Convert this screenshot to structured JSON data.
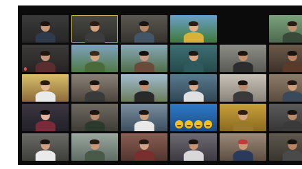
{
  "window": {
    "title": ""
  },
  "tiles": [
    {
      "bg": "#3a3a3a",
      "bg2": "#262626",
      "skin": "#c99b78",
      "hair": "#1d1410",
      "shirt": "#2f3a4a",
      "active": false,
      "muted": false
    },
    {
      "bg": "#4a4a44",
      "bg2": "#2b2b28",
      "skin": "#d2a27e",
      "hair": "#2a1c12",
      "shirt": "#3c3c3c",
      "active": true,
      "muted": false
    },
    {
      "bg": "#5a5650",
      "bg2": "#36332f",
      "skin": "#b8876a",
      "hair": "#1a1512",
      "shirt": "#445566",
      "active": false,
      "muted": false
    },
    {
      "bg": "#6aa0c8",
      "bg2": "#3f7a3a",
      "skin": "#e0b089",
      "hair": "#2d1f14",
      "shirt": "#d6b23a",
      "active": false,
      "muted": false
    },
    {
      "bg": "#0b0b0b",
      "bg2": "#0b0b0b",
      "skin": "#0b0b0b",
      "hair": "#0b0b0b",
      "shirt": "#0b0b0b",
      "active": false,
      "muted": false,
      "empty": true
    },
    {
      "bg": "#7aa27c",
      "bg2": "#4d6a4e",
      "skin": "#c2906e",
      "hair": "#2a1c12",
      "shirt": "#3a4a3a",
      "active": false,
      "muted": false
    },
    {
      "bg": "#3d3a3a",
      "bg2": "#262323",
      "skin": "#c8967a",
      "hair": "#1f1612",
      "shirt": "#5a2e2e",
      "active": false,
      "muted": true
    },
    {
      "bg": "#7fa2c0",
      "bg2": "#4f7a44",
      "skin": "#d6a886",
      "hair": "#3a2a1c",
      "shirt": "#4a6a3a",
      "active": false,
      "muted": false
    },
    {
      "bg": "#8aa8b8",
      "bg2": "#4f6f48",
      "skin": "#c99a80",
      "hair": "#151010",
      "shirt": "#6a4a3a",
      "active": false,
      "muted": false
    },
    {
      "bg": "#3d6f74",
      "bg2": "#254a4c",
      "skin": "#d8a887",
      "hair": "#1e1611",
      "shirt": "#2e5a5e",
      "active": false,
      "muted": false
    },
    {
      "bg": "#8e8e88",
      "bg2": "#5a5a55",
      "skin": "#c3906c",
      "hair": "#1b1410",
      "shirt": "#2d2d2d",
      "active": false,
      "muted": false
    },
    {
      "bg": "#6a5a4a",
      "bg2": "#3c3229",
      "skin": "#b98262",
      "hair": "#1a120e",
      "shirt": "#5a3a2a",
      "active": false,
      "muted": false
    },
    {
      "bg": "#d9c06a",
      "bg2": "#8c6a3a",
      "skin": "#e2b895",
      "hair": "#2a1c12",
      "shirt": "#eaeaea",
      "active": false,
      "muted": false
    },
    {
      "bg": "#8a8076",
      "bg2": "#4c453e",
      "skin": "#cf9f7f",
      "hair": "#1a1410",
      "shirt": "#3a3a3a",
      "active": false,
      "muted": false
    },
    {
      "bg": "#a2bcd0",
      "bg2": "#6a7c5a",
      "skin": "#c08c6c",
      "hair": "#120e0c",
      "shirt": "#2a2a2a",
      "active": false,
      "muted": false
    },
    {
      "bg": "#5a7a8e",
      "bg2": "#2f4654",
      "skin": "#d9aa8a",
      "hair": "#1b1410",
      "shirt": "#e0e0e0",
      "active": false,
      "muted": false
    },
    {
      "bg": "#c8c2b8",
      "bg2": "#8a847a",
      "skin": "#b9876a",
      "hair": "#1a1410",
      "shirt": "#3a3a3a",
      "active": false,
      "muted": false
    },
    {
      "bg": "#8c7c6a",
      "bg2": "#5a4c3e",
      "skin": "#cd9c7a",
      "hair": "#241912",
      "shirt": "#3b4a5a",
      "active": false,
      "muted": false
    },
    {
      "bg": "#3c3640",
      "bg2": "#22202a",
      "skin": "#e0b4a0",
      "hair": "#120e10",
      "shirt": "#7a2a3a",
      "active": false,
      "muted": false
    },
    {
      "bg": "#6e6a62",
      "bg2": "#3f3c36",
      "skin": "#b98a6a",
      "hair": "#1a1310",
      "shirt": "#2c3a2c",
      "active": false,
      "muted": false
    },
    {
      "bg": "#7a8ea0",
      "bg2": "#3c4e5e",
      "skin": "#caa080",
      "hair": "#1c1510",
      "shirt": "#e8e8e8",
      "active": false,
      "muted": false
    },
    {
      "bg": "#2e7ac8",
      "bg2": "#1a4c86",
      "skin": "#2e7ac8",
      "hair": "#2e7ac8",
      "shirt": "#2e7ac8",
      "active": false,
      "muted": false,
      "emoji": true
    },
    {
      "bg": "#c8a03a",
      "bg2": "#8a6a1e",
      "skin": "#d3a47f",
      "hair": "#2c1e12",
      "shirt": "#9a7a2a",
      "active": false,
      "muted": false
    },
    {
      "bg": "#5a5a5a",
      "bg2": "#363636",
      "skin": "#b98a6a",
      "hair": "#1a1410",
      "shirt": "#3a3a3a",
      "active": false,
      "muted": false
    },
    {
      "bg": "#6a6a66",
      "bg2": "#3e3e3a",
      "skin": "#d0a080",
      "hair": "#1b1410",
      "shirt": "#eaeaea",
      "active": false,
      "muted": false
    },
    {
      "bg": "#9aa8a0",
      "bg2": "#5e6c64",
      "skin": "#c89878",
      "hair": "#2a1c12",
      "shirt": "#4a5a4a",
      "active": false,
      "muted": false
    },
    {
      "bg": "#8a5e52",
      "bg2": "#523630",
      "skin": "#d2a284",
      "hair": "#241812",
      "shirt": "#7a2e2e",
      "active": false,
      "muted": false
    },
    {
      "bg": "#6e6a72",
      "bg2": "#3e3a42",
      "skin": "#c49474",
      "hair": "#1a1310",
      "shirt": "#d8d8d8",
      "active": false,
      "muted": false
    },
    {
      "bg": "#9c8a78",
      "bg2": "#5c4e42",
      "skin": "#c99878",
      "hair": "#c23a3a",
      "shirt": "#2a3a5a",
      "active": false,
      "muted": false
    },
    {
      "bg": "#5e584e",
      "bg2": "#38342e",
      "skin": "#b98464",
      "hair": "#181210",
      "shirt": "#4a4a4a",
      "active": false,
      "muted": false
    }
  ]
}
